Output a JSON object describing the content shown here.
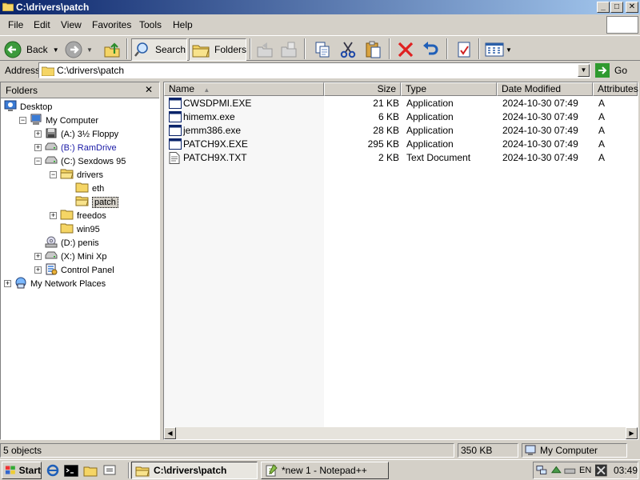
{
  "window": {
    "title": "C:\\drivers\\patch",
    "controls": {
      "minimize": "_",
      "maximize": "□",
      "close": "✕"
    }
  },
  "menubar": [
    "File",
    "Edit",
    "View",
    "Favorites",
    "Tools",
    "Help"
  ],
  "toolbar": {
    "back_label": "Back",
    "search_label": "Search",
    "folders_label": "Folders"
  },
  "address": {
    "label": "Address",
    "value": "C:\\drivers\\patch",
    "go_label": "Go"
  },
  "folders": {
    "title": "Folders",
    "close": "✕",
    "tree": [
      {
        "label": "Desktop",
        "level": 0,
        "expander": "",
        "icon": "desktop-icon"
      },
      {
        "label": "My Computer",
        "level": 1,
        "expander": "−",
        "icon": "computer-icon"
      },
      {
        "label": "(A:) 3½ Floppy",
        "level": 2,
        "expander": "+",
        "icon": "floppy-icon"
      },
      {
        "label": "(B:) RamDrive",
        "level": 2,
        "expander": "+",
        "icon": "drive-icon",
        "color": "#1a1aa6"
      },
      {
        "label": "(C:) Sexdows 95",
        "level": 2,
        "expander": "−",
        "icon": "drive-icon"
      },
      {
        "label": "drivers",
        "level": 3,
        "expander": "−",
        "icon": "folder-open-icon"
      },
      {
        "label": "eth",
        "level": 4,
        "expander": "",
        "icon": "folder-icon"
      },
      {
        "label": "patch",
        "level": 4,
        "expander": "",
        "icon": "folder-open-icon",
        "selected": true
      },
      {
        "label": "freedos",
        "level": 3,
        "expander": "+",
        "icon": "folder-icon"
      },
      {
        "label": "win95",
        "level": 3,
        "expander": "",
        "icon": "folder-icon"
      },
      {
        "label": "(D:) penis",
        "level": 2,
        "expander": "",
        "icon": "cdrom-icon"
      },
      {
        "label": "(X:) Mini Xp",
        "level": 2,
        "expander": "+",
        "icon": "drive-icon"
      },
      {
        "label": "Control Panel",
        "level": 2,
        "expander": "+",
        "icon": "control-panel-icon"
      },
      {
        "label": "My Network Places",
        "level": 1,
        "expander": "+",
        "icon": "network-icon",
        "level_override": 0
      }
    ]
  },
  "list": {
    "columns": [
      "Name",
      "Size",
      "Type",
      "Date Modified",
      "Attributes"
    ],
    "sort_indicator": "▲",
    "files": [
      {
        "name": "CWSDPMI.EXE",
        "size": "21 KB",
        "type": "Application",
        "modified": "2024-10-30 07:49",
        "attr": "A",
        "icon": "app-icon"
      },
      {
        "name": "himemx.exe",
        "size": "6 KB",
        "type": "Application",
        "modified": "2024-10-30 07:49",
        "attr": "A",
        "icon": "app-icon"
      },
      {
        "name": "jemm386.exe",
        "size": "28 KB",
        "type": "Application",
        "modified": "2024-10-30 07:49",
        "attr": "A",
        "icon": "app-icon"
      },
      {
        "name": "PATCH9X.EXE",
        "size": "295 KB",
        "type": "Application",
        "modified": "2024-10-30 07:49",
        "attr": "A",
        "icon": "app-icon"
      },
      {
        "name": "PATCH9X.TXT",
        "size": "2 KB",
        "type": "Text Document",
        "modified": "2024-10-30 07:49",
        "attr": "A",
        "icon": "text-doc-icon"
      }
    ]
  },
  "status": {
    "objects": "5 objects",
    "size": "350 KB",
    "location": "My Computer"
  },
  "taskbar": {
    "start_label": "Start",
    "tasks": [
      {
        "label": "C:\\drivers\\patch",
        "active": true
      },
      {
        "label": "*new 1 - Notepad++",
        "active": false
      }
    ],
    "tray": {
      "lang": "EN",
      "clock": "03:49"
    }
  }
}
